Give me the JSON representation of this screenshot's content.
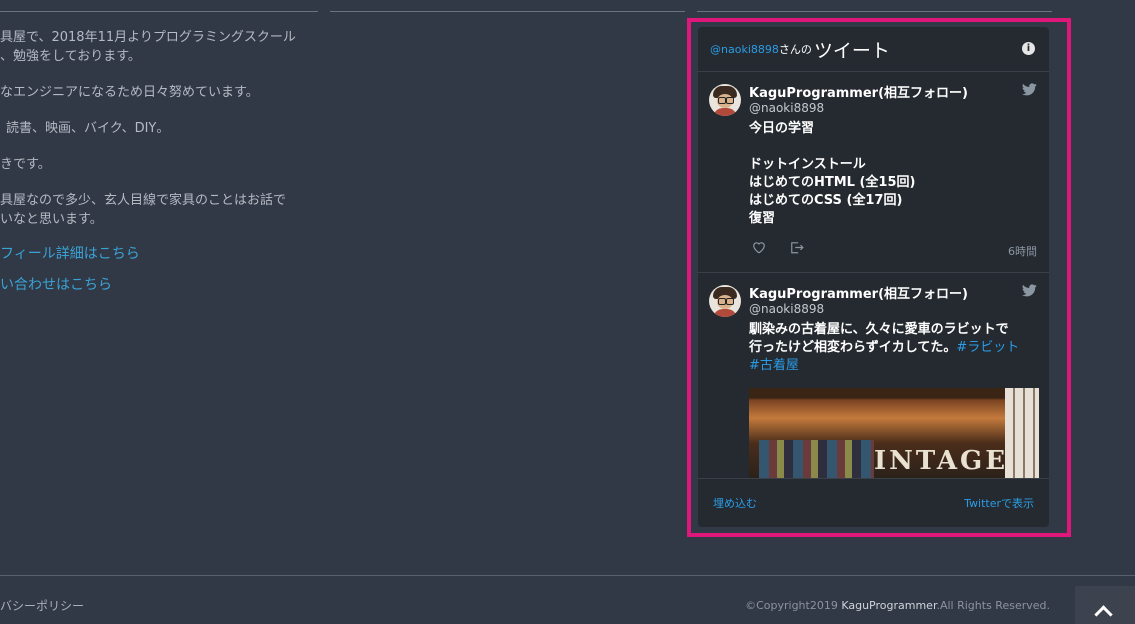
{
  "about": {
    "lines": [
      "具屋で、2018年11月よりプログラミングスクール",
      "、勉強をしております。",
      "なエンジニアになるため日々努めています。",
      "読書、映画、バイク、DIY。",
      "きです。",
      "具屋なので多少、玄人目線で家具のことはお話で",
      "いなと思います。"
    ],
    "profile_link": "フィール詳細はこちら",
    "contact_link": "い合わせはこちら"
  },
  "twitter_widget": {
    "header": {
      "handle": "@naoki8898",
      "san_no": "さんの",
      "title": "ツイート"
    },
    "tweets": [
      {
        "name": "KaguProgrammer(相互フォロー)",
        "handle": "@naoki8898",
        "lines": [
          "今日の学習",
          "",
          "ドットインストール",
          "はじめてのHTML (全15回)",
          "はじめてのCSS (全17回)",
          "復習"
        ],
        "time": "6時間"
      },
      {
        "name": "KaguProgrammer(相互フォロー)",
        "handle": "@naoki8898",
        "line1": "馴染みの古着屋に、久々に愛車のラビットで",
        "line2": "行ったけど相変わらずイカしてた。",
        "hashtag1": "#ラビット",
        "hashtag2": "#古着屋",
        "photo_sign": "INTAGE"
      }
    ],
    "footer": {
      "embed": "埋め込む",
      "view_on_twitter": "Twitterで表示"
    }
  },
  "footer": {
    "privacy": "バシーポリシー",
    "copyright_prefix": "©Copyright2019 ",
    "copyright_brand": "KaguProgrammer",
    "copyright_suffix": ".All Rights Reserved."
  },
  "colors": {
    "accent_pink": "#e0177a",
    "twitter_blue": "#2b9ce6",
    "link_blue": "#3aa3d6"
  }
}
